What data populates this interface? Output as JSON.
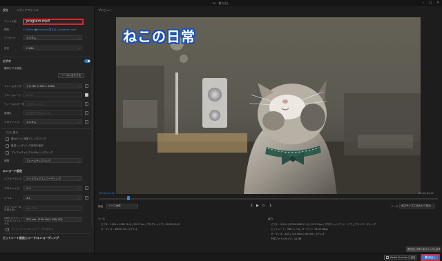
{
  "window": {
    "title": "xx - 書き出し"
  },
  "left_panel": {
    "tab_settings": "設定",
    "tab_media": "メディアファイル",
    "filename_label": "ファイル名",
    "filename_value": "program.mp4",
    "location_label": "場所",
    "location_value": "C:\\Users\\●\\Desktop\\書き出し\\program.mp4",
    "preset_label": "プリセット",
    "preset_value": "カスタム",
    "format_label": "形式",
    "format_value": "H.264",
    "video_section": "ビデオ",
    "basic_settings": "基本ビデオ設定",
    "match_source_button": "ソースに合わせる",
    "frame_size_label": "フレームサイズ",
    "frame_size_value": "フル HD（1920 x 1080）",
    "frame_rate_label": "フレームレート",
    "frame_rate_value": "29.97",
    "field_order_label": "フィールドオーダー",
    "field_order_value": "プログレッシブ",
    "aspect_label": "縦横比",
    "aspect_value": "正方形ピクセル (1.0)",
    "profile_label": "プロファイル",
    "profile_value": "カスタム",
    "more_label": "さらに表示",
    "max_depth_label": "最大ビット深度でレンダリング",
    "max_quality_label": "最高レンダリング品質を使用",
    "alpha_label": "アルファチャンネルのみレンダリング",
    "time_interp_label": "補間",
    "time_interp_value": "フレームサンプリング",
    "encode_section": "エンコード設定",
    "perf_label": "パフォーマンス",
    "perf_value": "ハードウェアエンコーディング",
    "profile2_label": "プロファイル",
    "profile2_value": "ハイ",
    "level_label": "レベル",
    "level_value": "4.2",
    "hdr_label": "カラースペースを書き出し",
    "hdr_value": "Rec. 709",
    "hdr_graphics_label": "HDR グラフィックのホワイトレベル",
    "hdr_graphics_value": "203 nits（75% HLG, 58% PQ）",
    "display_label": "ディスプレイHDRメタデータを含める",
    "bitrate_section": "ビットレート設定とコーラ/エンコーディング"
  },
  "preview": {
    "title": "プレビュー",
    "caption": "ねこの日常",
    "timecode_in": "00;00;01;12",
    "timecode_out": "00;00;24;12",
    "range_label": "範囲",
    "range_value": "ソース全体",
    "scale_label": "ソース",
    "scale_value": "出力サイズに合わせて拡大"
  },
  "source_info": {
    "heading": "ソース",
    "video": "ビデオ：1920 x 1080 (1.0) | 29.97 fps | プログレッシブ | 00;00;24;12",
    "audio": "オーディオ：48000 Hz | ステレオ"
  },
  "output_info": {
    "heading": "出力",
    "video": "ビデオ：H.264 | 1920x1080 (1.0) | 29.97 fps | プログレッシブ | ハードウェアエンコーディング",
    "bitrate": "ビットレート：VBR, 1 パス, ターゲット 16.00 Mbps",
    "audio": "オーディオ：AAC | 320 Kbps | 48 kHz | ステレオ",
    "size": "予測ファイルサイズ：33 MB"
  },
  "bottom": {
    "encoder_button": "Media Encoder に送信",
    "export_button": "書き出し",
    "tooltip": "書き出しボタンをクリックします"
  },
  "colors": {
    "accent": "#2e7bd6",
    "highlight": "#e0242c",
    "timecode": "#2e86e0"
  }
}
